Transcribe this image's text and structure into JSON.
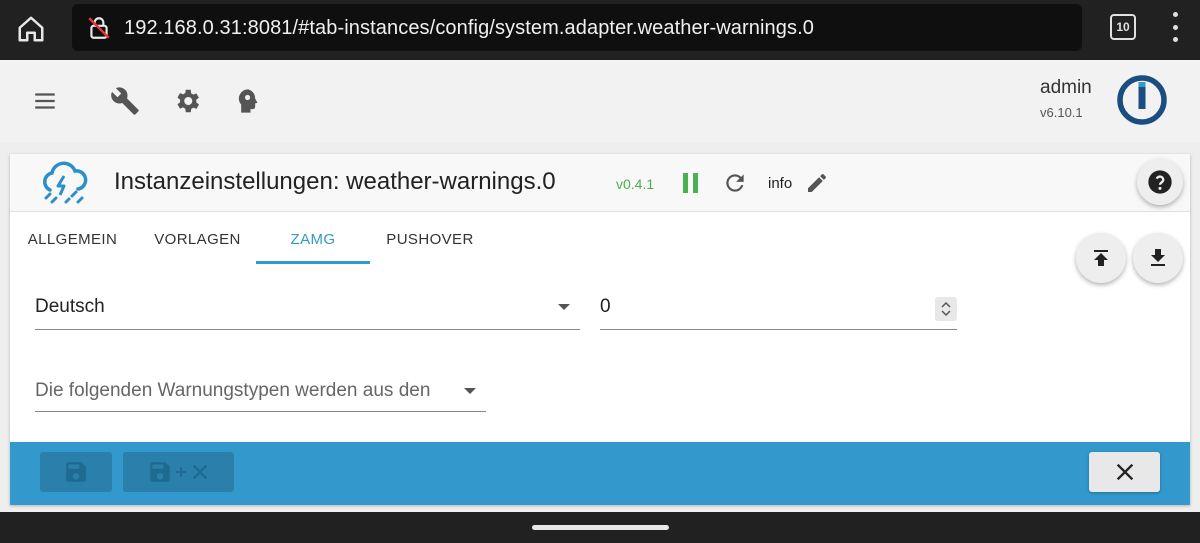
{
  "browser": {
    "url": "192.168.0.31:8081/#tab-instances/config/system.adapter.weather-warnings.0",
    "tab_count": "10"
  },
  "header": {
    "user": "admin",
    "version": "v6.10.1"
  },
  "instance": {
    "title": "Instanzeinstellungen: weather-warnings.0",
    "version": "v0.4.1",
    "info_label": "info"
  },
  "tabs": [
    {
      "label": "ALLGEMEIN",
      "active": false
    },
    {
      "label": "VORLAGEN",
      "active": false
    },
    {
      "label": "ZAMG",
      "active": true
    },
    {
      "label": "PUSHOVER",
      "active": false
    }
  ],
  "form": {
    "language_value": "Deutsch",
    "number_value": "0",
    "warning_types_placeholder": "Die folgenden Warnungstypen werden aus den"
  },
  "colors": {
    "accent": "#3399cc",
    "running": "#4caf50",
    "footer": "#3399cc"
  },
  "icons": [
    "home-icon",
    "insecure-lock-icon",
    "menu-icon",
    "wrench-icon",
    "gear-icon",
    "head-icon",
    "iobroker-logo",
    "weather-cloud-icon",
    "pause-icon",
    "reload-icon",
    "edit-icon",
    "help-icon",
    "upload-icon",
    "download-icon",
    "save-icon",
    "save-close-icon",
    "close-icon"
  ]
}
